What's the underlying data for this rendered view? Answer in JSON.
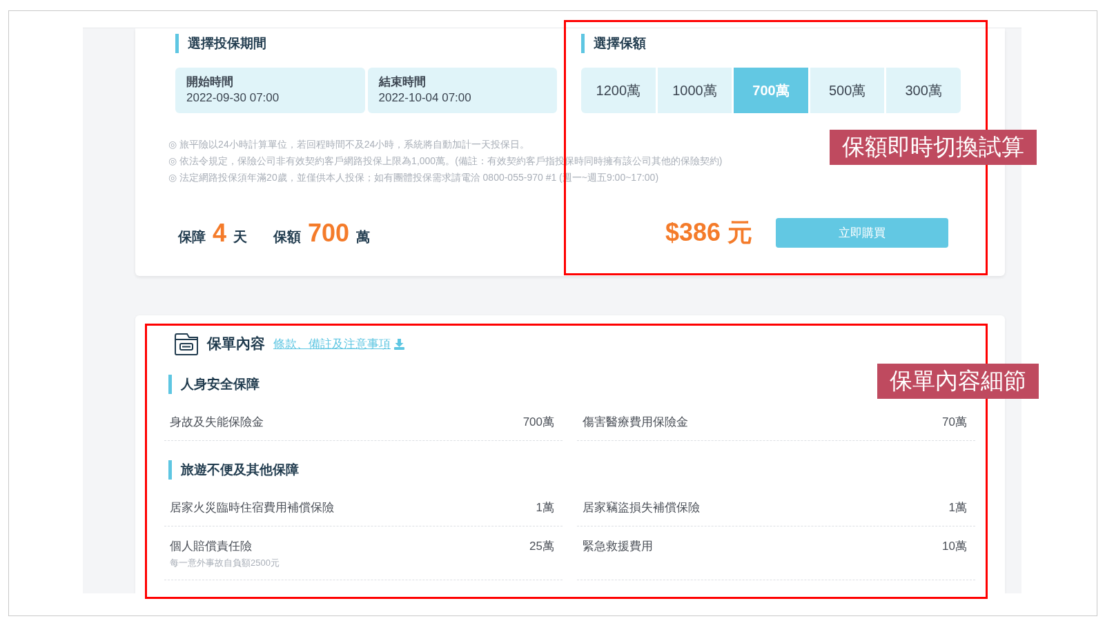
{
  "period": {
    "title": "選擇投保期間",
    "start": {
      "label": "開始時間",
      "value": "2022-09-30 07:00"
    },
    "end": {
      "label": "結束時間",
      "value": "2022-10-04 07:00"
    }
  },
  "coverage": {
    "title": "選擇保額",
    "options": [
      {
        "label": "1200萬",
        "selected": false
      },
      {
        "label": "1000萬",
        "selected": false
      },
      {
        "label": "700萬",
        "selected": true
      },
      {
        "label": "500萬",
        "selected": false
      },
      {
        "label": "300萬",
        "selected": false
      }
    ]
  },
  "notes": [
    "◎ 旅平險以24小時計算單位，若回程時間不及24小時，系統將自動加計一天投保日。",
    "◎ 依法令規定，保險公司非有效契約客戶網路投保上限為1,000萬。(備註：有效契約客戶指投保時同時擁有該公司其他的保險契約)",
    "◎ 法定網路投保須年滿20歲，並僅供本人投保；如有團體投保需求請電洽 0800-055-970 #1 (週一~週五9:00~17:00)"
  ],
  "summary": {
    "days_label": "保障",
    "days": "4",
    "days_unit": "天",
    "amount_label": "保額",
    "amount": "700",
    "amount_unit": "萬"
  },
  "price": "$386 元",
  "buy_button": "立即購買",
  "policy": {
    "title": "保單內容",
    "link": "條款、備註及注意事項",
    "sections": [
      {
        "title": "人身安全保障",
        "items": [
          {
            "name": "身故及失能保險金",
            "value": "700萬"
          },
          {
            "name": "傷害醫療費用保險金",
            "value": "70萬"
          }
        ]
      },
      {
        "title": "旅遊不便及其他保障",
        "items": [
          {
            "name": "居家火災臨時住宿費用補償保險",
            "value": "1萬"
          },
          {
            "name": "居家竊盜損失補償保險",
            "value": "1萬"
          },
          {
            "name": "個人賠償責任險",
            "value": "25萬",
            "note": "每一意外事故自負額2500元"
          },
          {
            "name": "緊急救援費用",
            "value": "10萬"
          }
        ]
      }
    ]
  },
  "annotations": [
    {
      "label": "保額即時切換試算"
    },
    {
      "label": "保單內容細節"
    }
  ]
}
